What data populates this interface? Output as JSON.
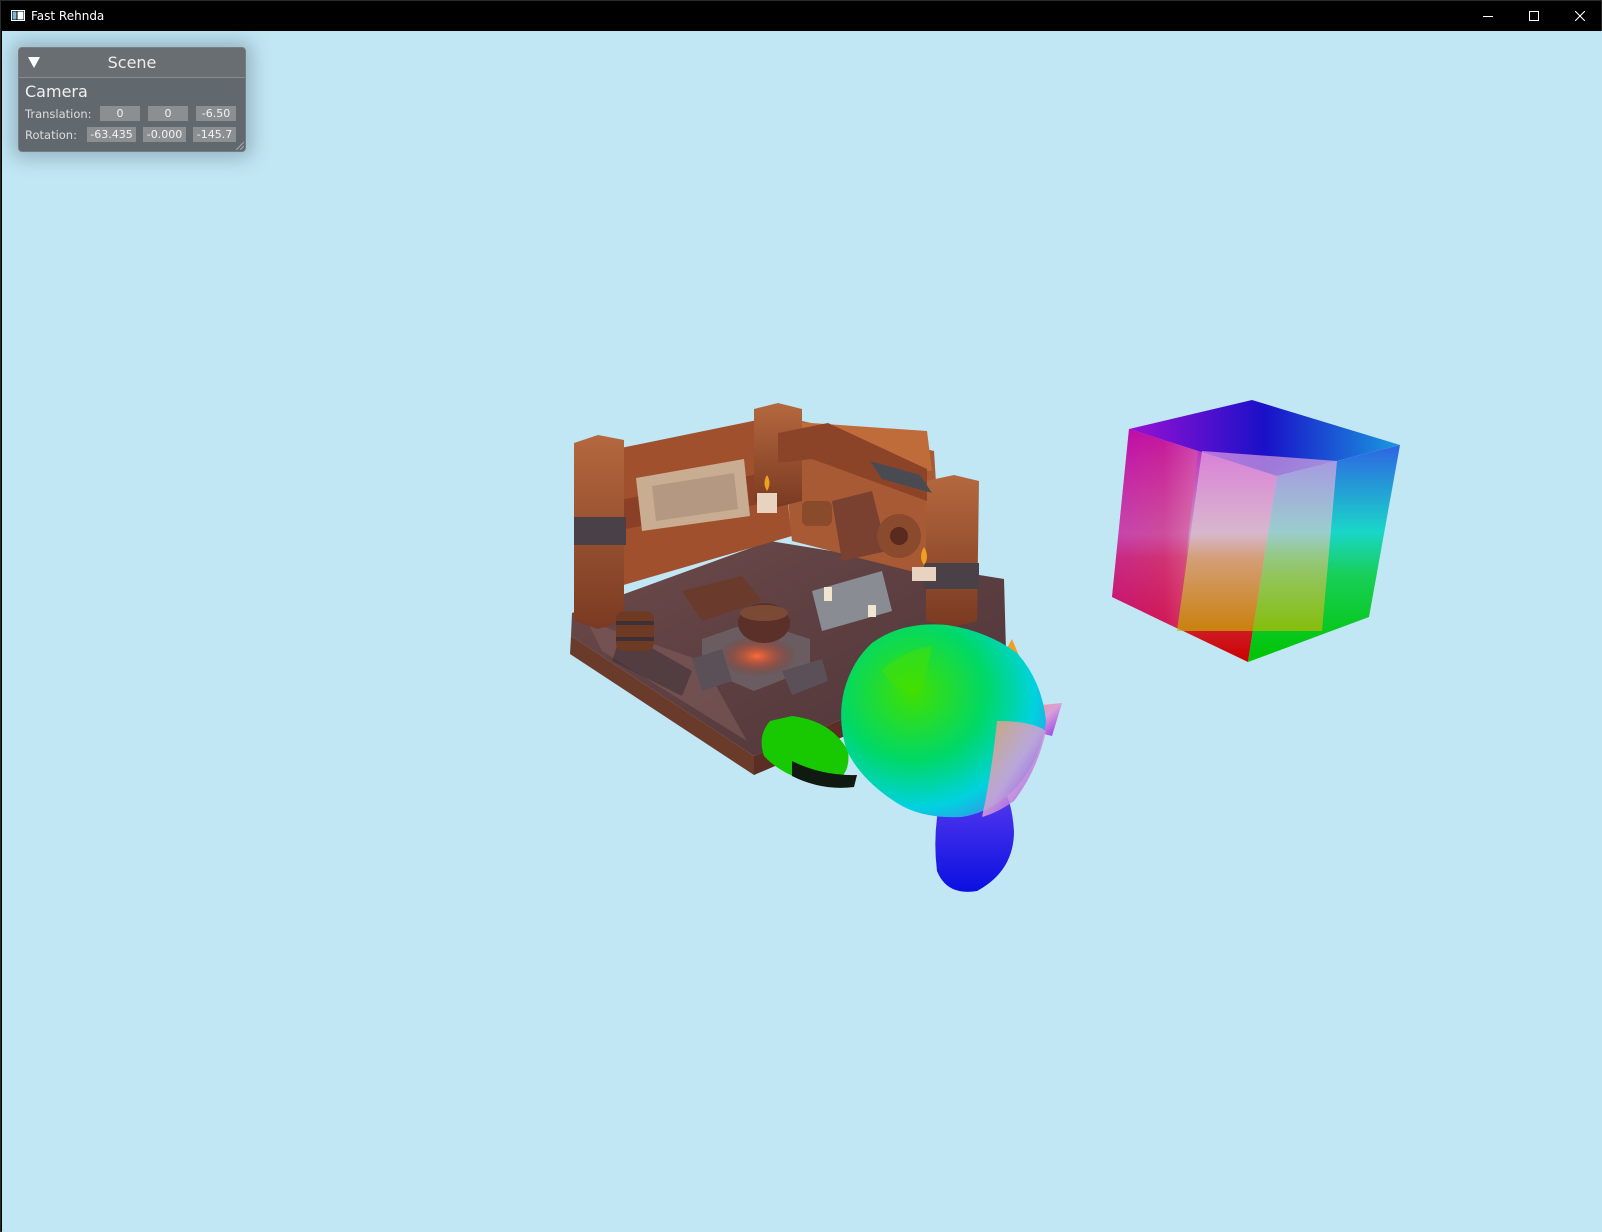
{
  "window": {
    "title": "Fast Rehnda",
    "icons": {
      "app": "window-app-icon",
      "minimize": "minimize-icon",
      "maximize": "maximize-icon",
      "close": "close-icon"
    }
  },
  "viewport": {
    "background": "#c1e6f4",
    "objects": [
      "diorama-model",
      "monkey-head-model",
      "rgb-cube-model"
    ]
  },
  "scene_panel": {
    "title": "Scene",
    "collapse_icon": "triangle-down-icon",
    "section": "Camera",
    "translation": {
      "label": "Translation:",
      "x": "0",
      "y": "0",
      "z": "-6.50"
    },
    "rotation": {
      "label": "Rotation:",
      "x": "-63.435",
      "y": "-0.000",
      "z": "-145.7"
    }
  }
}
